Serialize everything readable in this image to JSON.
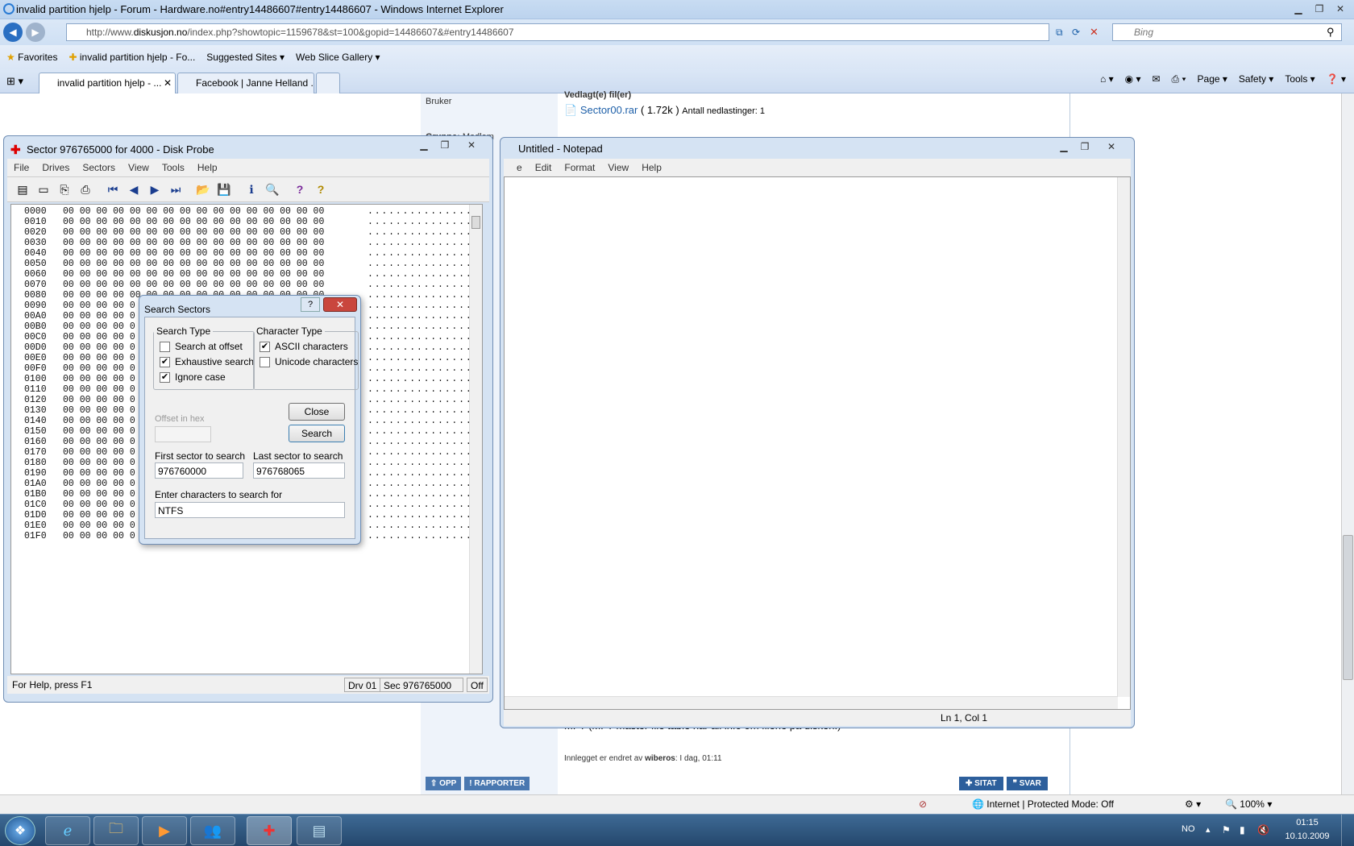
{
  "ie": {
    "title": "invalid partition hjelp - Forum - Hardware.no#entry14486607#entry14486607 - Windows Internet Explorer",
    "url_prefix": "http://www.",
    "url_domain": "diskusjon.no",
    "url_rest": "/index.php?showtopic=1159678&st=100&gopid=14486607&#entry14486607",
    "search_placeholder": "Bing",
    "favorites_label": "Favorites",
    "fav_items": [
      "invalid partition hjelp - Fo...",
      "Suggested Sites",
      "Web Slice Gallery"
    ],
    "tabs": [
      "invalid partition hjelp - ...",
      "Facebook | Janne Helland ..."
    ],
    "cmd": [
      "Page",
      "Safety",
      "Tools"
    ]
  },
  "forum": {
    "user_label": "Bruker",
    "group_label": "Gruppe:",
    "group_value": "Medlem",
    "attached_header": "Vedlagt(e) fil(er)",
    "file_name": "Sector00.rar",
    "file_size": "( 1.72k )",
    "downloads": "Antall nedlastinger: 1",
    "post_text_tail": "MFT (MFT master file table har all info om filene på disken.)",
    "edited_prefix": "Innlegget er endret av",
    "edited_by": "wiberos",
    "edited_when": ": I dag, 01:11",
    "btn_opp": "OPP",
    "btn_rapporter": "RAPPORTER",
    "btn_sitat": "SITAT",
    "btn_svar": "SVAR"
  },
  "diskprobe": {
    "title": "Sector 976765000 for 4000 - Disk Probe",
    "menu": [
      "File",
      "Drives",
      "Sectors",
      "View",
      "Tools",
      "Help"
    ],
    "offsets": [
      "0000",
      "0010",
      "0020",
      "0030",
      "0040",
      "0050",
      "0060",
      "0070",
      "0080",
      "0090",
      "00A0",
      "00B0",
      "00C0",
      "00D0",
      "00E0",
      "00F0",
      "0100",
      "0110",
      "0120",
      "0130",
      "0140",
      "0150",
      "0160",
      "0170",
      "0180",
      "0190",
      "01A0",
      "01B0",
      "01C0",
      "01D0",
      "01E0",
      "01F0"
    ],
    "row_full": "00 00 00 00 00 00 00 00 00 00 00 00 00 00 00 00",
    "row_part": "00 00 00 00 0",
    "ascii": "................",
    "status_help": "For Help, press F1",
    "status_drv": "Drv  01",
    "status_sec": "Sec 976765000",
    "status_off": "Off"
  },
  "notepad": {
    "title": "Untitled - Notepad",
    "menu": [
      "e",
      "Edit",
      "Format",
      "View",
      "Help"
    ],
    "status_pos": "Ln 1, Col 1"
  },
  "search_dialog": {
    "title": "Search Sectors",
    "search_type_legend": "Search Type",
    "opt_offset": "Search at offset",
    "opt_exhaustive": "Exhaustive search",
    "opt_ignore": "Ignore case",
    "char_type_legend": "Character Type",
    "opt_ascii": "ASCII characters",
    "opt_unicode": "Unicode characters",
    "offset_label": "Offset in hex",
    "close_label": "Close",
    "search_label": "Search",
    "first_label": "First sector to search",
    "first_value": "976760000",
    "last_label": "Last sector to search",
    "last_value": "976768065",
    "chars_label": "Enter characters to search for",
    "chars_value": "NTFS",
    "checked": {
      "offset": false,
      "exhaustive": true,
      "ignore": true,
      "ascii": true,
      "unicode": false
    }
  },
  "statusbar": {
    "zone": "Internet | Protected Mode: Off",
    "zoom": "100%"
  },
  "taskbar": {
    "lang": "NO",
    "time": "01:15",
    "date": "10.10.2009"
  }
}
